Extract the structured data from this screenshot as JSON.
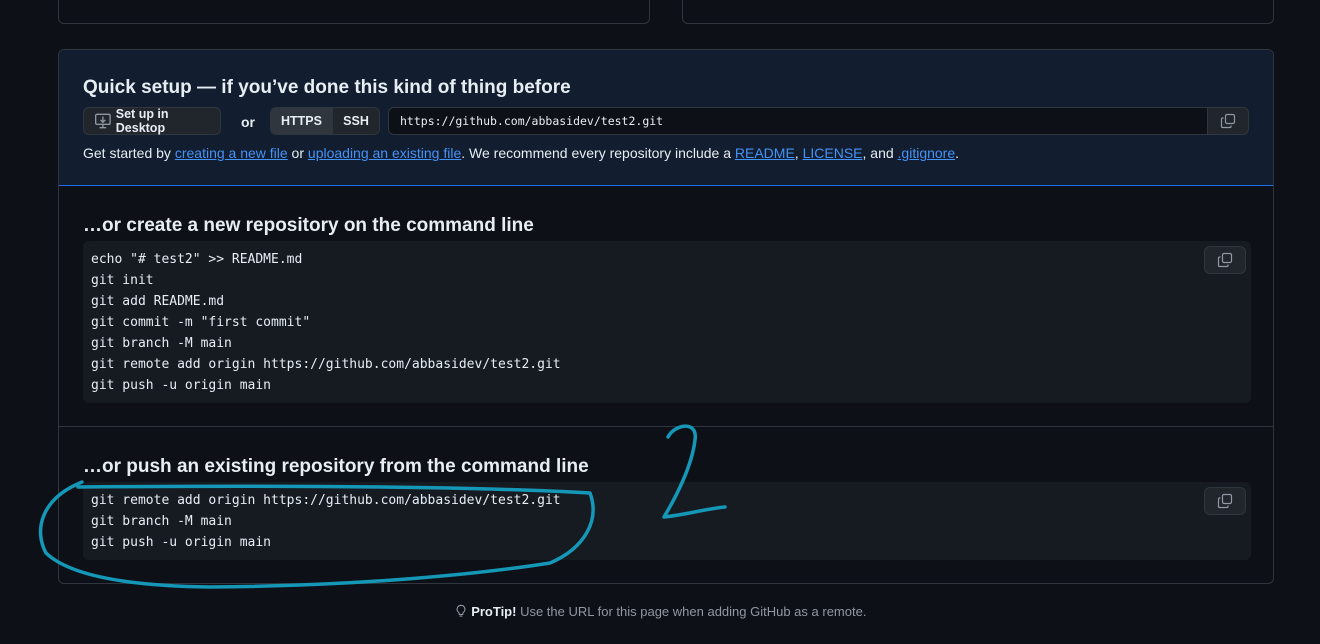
{
  "quick_setup": {
    "title": "Quick setup — if you’ve done this kind of thing before",
    "desktop_label": "Set up in Desktop",
    "or_label": "or",
    "https_label": "HTTPS",
    "ssh_label": "SSH",
    "clone_url": "https://github.com/abbasidev/test2.git",
    "desc": {
      "start": "Get started by ",
      "link_new_file": "creating a new file",
      "or": " or ",
      "link_upload": "uploading an existing file",
      "mid": ". We recommend every repository include a ",
      "link_readme": "README",
      "comma1": ", ",
      "link_license": "LICENSE",
      "and": ", and ",
      "link_gitignore": ".gitignore",
      "end": "."
    }
  },
  "new_repo": {
    "title": "…or create a new repository on the command line",
    "lines": [
      "echo \"# test2\" >> README.md",
      "git init",
      "git add README.md",
      "git commit -m \"first commit\"",
      "git branch -M main",
      "git remote add origin https://github.com/abbasidev/test2.git",
      "git push -u origin main"
    ]
  },
  "push_existing": {
    "title": "…or push an existing repository from the command line",
    "lines": [
      "git remote add origin https://github.com/abbasidev/test2.git",
      "git branch -M main",
      "git push -u origin main"
    ]
  },
  "protip": {
    "label": "ProTip!",
    "text": " Use the URL for this page when adding GitHub as a remote."
  },
  "annotation": {
    "number": "2",
    "color": "#1597b8"
  },
  "icons": {
    "desktop": "desktop-download-icon",
    "copy": "copy-icon",
    "protip": "light-bulb-icon"
  }
}
